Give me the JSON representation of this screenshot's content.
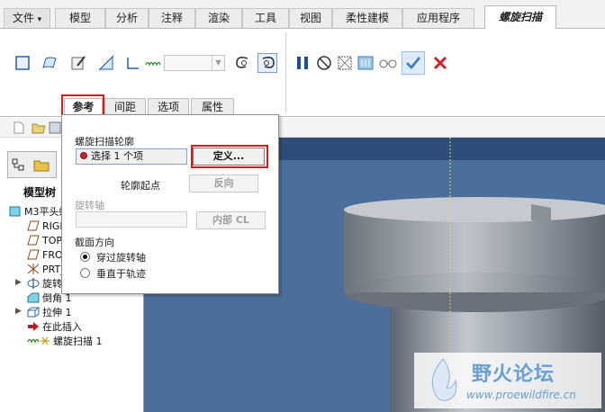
{
  "menubar": {
    "tabs": [
      {
        "label": "文件",
        "dropdown": "▾"
      },
      {
        "label": "模型"
      },
      {
        "label": "分析"
      },
      {
        "label": "注释"
      },
      {
        "label": "渲染"
      },
      {
        "label": "工具"
      },
      {
        "label": "视图"
      },
      {
        "label": "柔性建模"
      },
      {
        "label": "应用程序"
      },
      {
        "label": "螺旋扫描"
      }
    ],
    "active_tab": "螺旋扫描"
  },
  "ribbon": {
    "subtabs": [
      "参考",
      "间距",
      "选项",
      "属性"
    ],
    "active_subtab": "参考",
    "value_dropdown": ""
  },
  "ref_panel": {
    "profile_label": "螺旋扫描轮廓",
    "collector_value": "选择 1 个项",
    "define_button": "定义...",
    "start_label": "轮廓起点",
    "reverse_button": "反向",
    "axis_label": "旋转轴",
    "internal_cl_button": "内部 CL",
    "section_label": "截面方向",
    "options": [
      {
        "label": "穿过旋转轴",
        "selected": true
      },
      {
        "label": "垂直于轨迹",
        "selected": false
      }
    ]
  },
  "model_tree": {
    "title": "模型树",
    "items": [
      {
        "label": "M3平头螺",
        "icon": "part-icon"
      },
      {
        "label": "RIGH",
        "icon": "datum-plane-icon"
      },
      {
        "label": "TOP",
        "icon": "datum-plane-icon"
      },
      {
        "label": "FRON",
        "icon": "datum-plane-icon"
      },
      {
        "label": "PRT_",
        "icon": "csys-icon"
      },
      {
        "label": "旋转",
        "icon": "revolve-icon"
      },
      {
        "label": "倒角 1",
        "icon": "chamfer-icon"
      },
      {
        "label": "拉伸 1",
        "icon": "extrude-icon"
      },
      {
        "label": "在此插入",
        "icon": "insert-here-icon"
      },
      {
        "label": "螺旋扫描 1",
        "icon": "helical-sweep-icon"
      }
    ]
  },
  "watermark": {
    "title": "野火论坛",
    "url": "www.proewildfire.cn"
  },
  "colors": {
    "viewport_bg": "#4b6f9a",
    "red_highlight": "#d41c1c",
    "cancel_red": "#d0202a",
    "accept_blue": "#3a78c2"
  }
}
